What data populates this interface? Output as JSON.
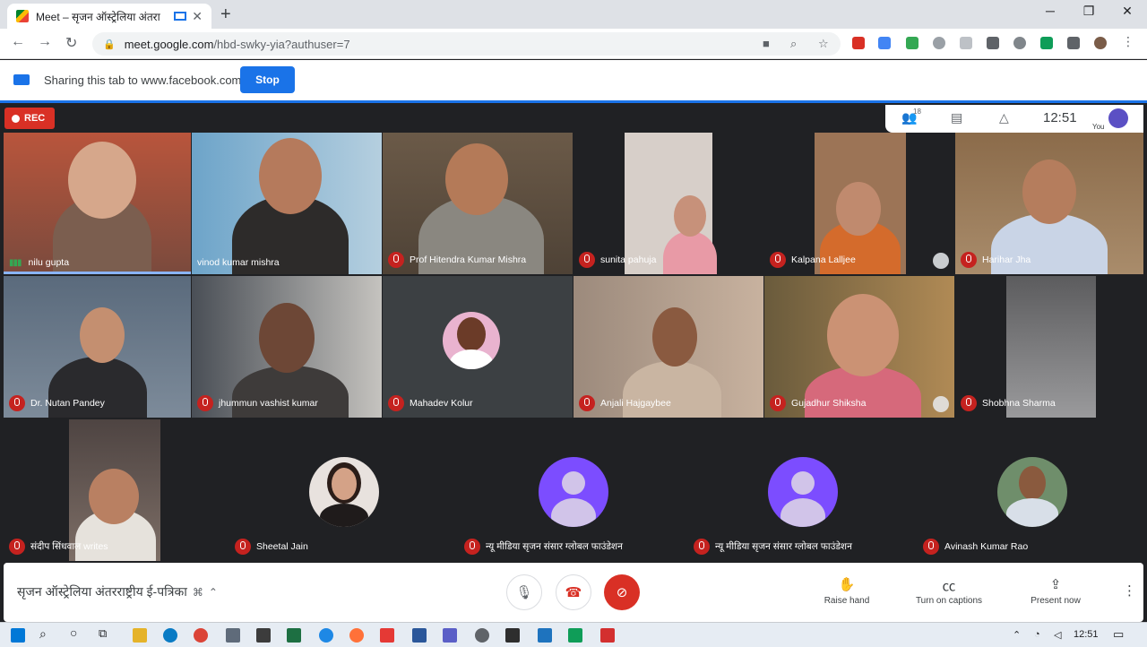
{
  "browser": {
    "tab_title": "Meet – सृजन ऑस्ट्रेलिया अंतरा",
    "url_main": "meet.google.com",
    "url_rest": "/hbd-swky-yia?authuser=7"
  },
  "sharing": {
    "text": "Sharing this tab to www.facebook.com",
    "stop_label": "Stop"
  },
  "meet": {
    "rec_label": "REC",
    "participant_count": "18",
    "clock": "12:51",
    "you_label": "You",
    "meeting_title": "सृजन ऑस्ट्रेलिया अंतरराष्ट्रीय ई-पत्रिका",
    "actions": {
      "raise_hand": "Raise hand",
      "captions": "Turn on captions",
      "present": "Present now"
    }
  },
  "participants": [
    {
      "name": "nilu gupta",
      "speaking": true
    },
    {
      "name": "vinod kumar mishra",
      "muted": false
    },
    {
      "name": "Prof Hitendra Kumar Mishra",
      "muted": true
    },
    {
      "name": "sunita pahuja",
      "muted": true
    },
    {
      "name": "Kalpana Lalljee",
      "muted": true
    },
    {
      "name": "Harihar Jha",
      "muted": true
    },
    {
      "name": "Dr. Nutan Pandey",
      "muted": true
    },
    {
      "name": "jhummun vashist kumar",
      "muted": true
    },
    {
      "name": "Mahadev Kolur",
      "muted": true
    },
    {
      "name": "Anjali Hajgaybee",
      "muted": true
    },
    {
      "name": "Gujadhur Shiksha",
      "muted": true
    },
    {
      "name": "Shobhna Sharma",
      "muted": true
    },
    {
      "name": "संदीप सिंधवाल writes",
      "muted": true
    },
    {
      "name": "Sheetal Jain",
      "muted": true
    },
    {
      "name": "न्यू मीडिया सृजन संसार ग्लोबल फाउंडेशन",
      "muted": true
    },
    {
      "name": "न्यू मीडिया सृजन संसार ग्लोबल फाउंडेशन",
      "muted": true
    },
    {
      "name": "Avinash Kumar Rao",
      "muted": true
    }
  ],
  "taskbar": {
    "time": "12:51"
  }
}
